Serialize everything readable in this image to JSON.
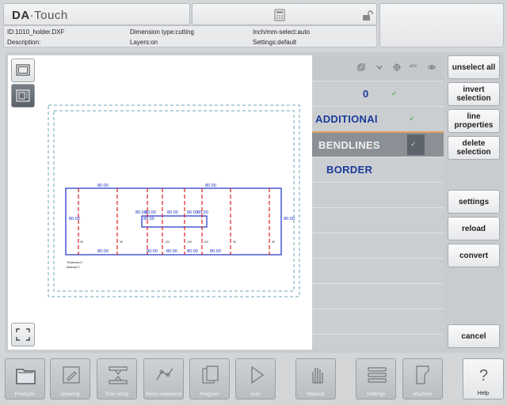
{
  "app": {
    "logo_main": "DA",
    "logo_sep": "·",
    "logo_sub": "Touch"
  },
  "info": {
    "id": "ID:1010_holder.DXF",
    "description": "Description:",
    "dimension_type": "Dimension type:cutting",
    "layers": "Layers:on",
    "units": "Inch/mm-select:auto",
    "settings": "Settings:default"
  },
  "layers": [
    {
      "name": "0",
      "visible_check": "✓",
      "selected": false
    },
    {
      "name": "ADDITIONAl",
      "visible_check": "✓",
      "selected": false
    },
    {
      "name": "BENDLINES",
      "visible_check": "✓",
      "selected": true
    },
    {
      "name": "BORDER",
      "visible_check": "",
      "selected": false
    }
  ],
  "layer_header_icons": [
    "layers-icon",
    "chevron-down-icon",
    "crosshair-icon",
    "abc-icon",
    "eye-icon"
  ],
  "layer_header_abc": "abc",
  "side_buttons": {
    "unselect_all": "unselect all",
    "invert_selection": "invert selection",
    "line_properties": "line properties",
    "delete_selection": "delete selection",
    "settings": "settings",
    "reload": "reload",
    "convert": "convert",
    "cancel": "cancel"
  },
  "bottom_nav": [
    {
      "label": "Products",
      "icon": "folder-icon"
    },
    {
      "label": "Drawing",
      "icon": "pencil-icon"
    },
    {
      "label": "Tool setup",
      "icon": "tool-setup-icon"
    },
    {
      "label": "Bend sequence",
      "icon": "bend-sequence-icon"
    },
    {
      "label": "Program",
      "icon": "program-pages-icon"
    },
    {
      "label": "Auto",
      "icon": "play-icon"
    },
    {
      "label": "Manual",
      "icon": "hand-icon"
    },
    {
      "label": "Settings",
      "icon": "settings-list-icon"
    },
    {
      "label": "Machine",
      "icon": "machine-icon"
    }
  ],
  "help": {
    "glyph": "?",
    "label": "Help"
  },
  "drawing": {
    "dims_top": [
      "80.00",
      "80.00"
    ],
    "dims_mid": [
      "80.00",
      "80.00",
      "80.00",
      "80.00",
      "80.00",
      "80.00"
    ],
    "dims_bottom": [
      "80.00",
      "80.00",
      "80.00",
      "80.00",
      "80.00"
    ],
    "dims_side": [
      "80.00",
      "80.00"
    ],
    "small_marks": [
      "90",
      "90",
      "120",
      "120",
      "120",
      "90",
      "90"
    ],
    "note_lines": [
      "Thickness=2",
      "Material=2"
    ]
  },
  "colors": {
    "dim_blue": "#1b2fc4",
    "bend_red": "#e02020",
    "border_dash": "#6fa3b8"
  }
}
